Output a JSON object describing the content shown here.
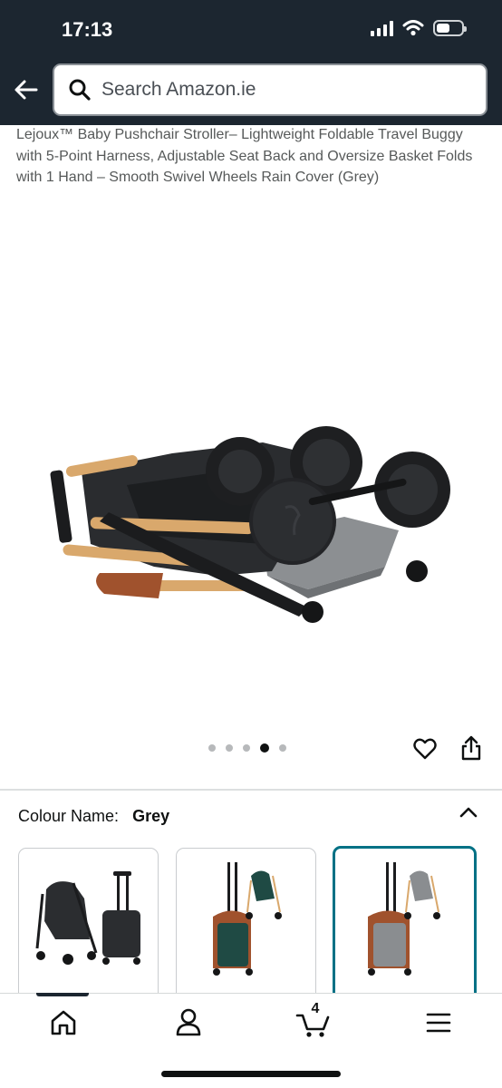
{
  "status_bar": {
    "time": "17:13"
  },
  "search": {
    "placeholder": "Search Amazon.ie"
  },
  "product": {
    "title": "Lejoux™ Baby Pushchair Stroller– Lightweight Foldable Travel Buggy with 5-Point Harness, Adjustable Seat Back and Oversize Basket Folds with 1 Hand – Smooth Swivel Wheels Rain Cover (Grey)"
  },
  "carousel": {
    "total": 5,
    "active_index": 4
  },
  "colour": {
    "label": "Colour Name:",
    "value": "Grey"
  },
  "swatches": [
    {
      "name": "Black",
      "color": "#2b2d30"
    },
    {
      "name": "Green",
      "color": "#1f4a44"
    },
    {
      "name": "Grey",
      "color": "#8a8d90",
      "selected": true
    }
  ],
  "bottom_nav": {
    "cart_count": "4",
    "items": [
      "home-icon",
      "account-icon",
      "cart-icon",
      "menu-icon"
    ]
  },
  "colors": {
    "header_bg": "#1c2630",
    "accent": "#007185"
  }
}
